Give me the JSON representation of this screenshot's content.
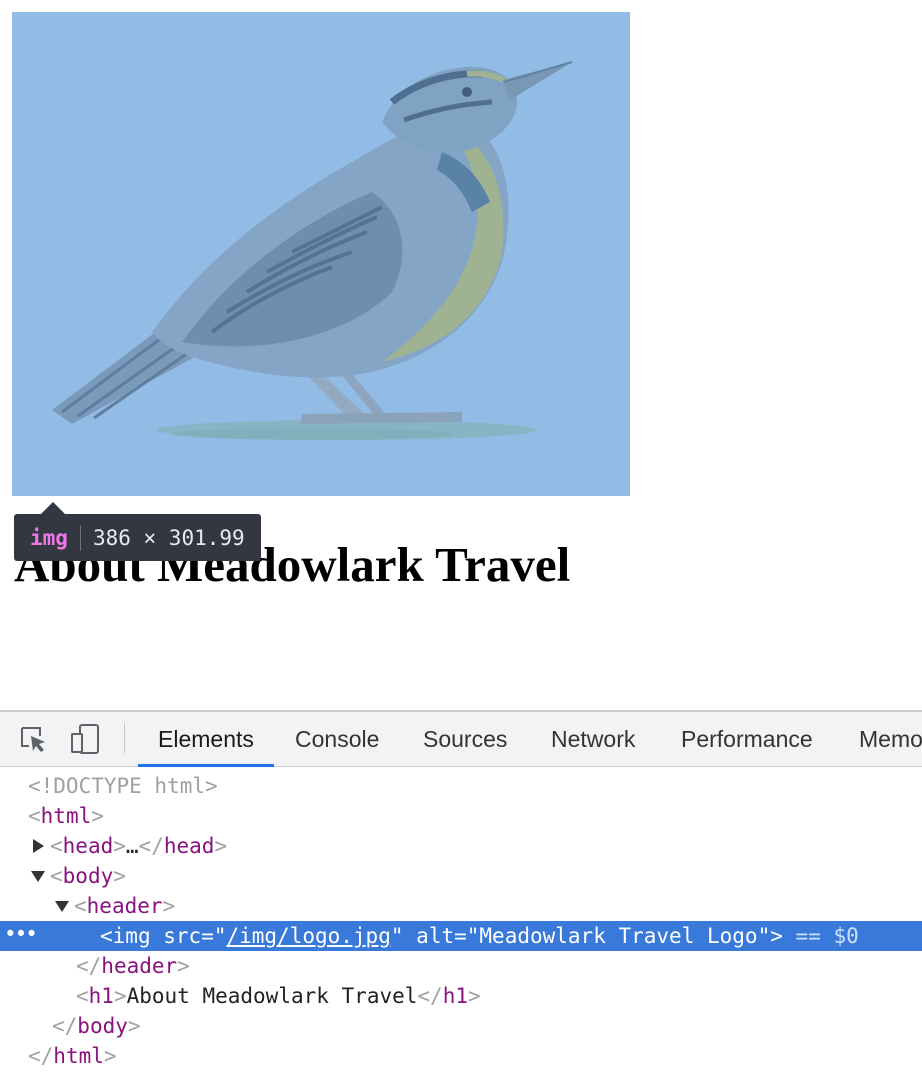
{
  "page": {
    "title": "About Meadowlark Travel",
    "logo_alt": "Meadowlark Travel Logo"
  },
  "tooltip": {
    "tag": "img",
    "size": "386 × 301.99"
  },
  "devtools": {
    "tabs": [
      "Elements",
      "Console",
      "Sources",
      "Network",
      "Performance",
      "Memo"
    ],
    "active_tab": "Elements",
    "icons": [
      "inspect-element-icon",
      "device-toolbar-icon"
    ],
    "tree": {
      "doctype": "<!DOCTYPE html>",
      "html_open": "html",
      "head_tag": "head",
      "head_ellipsis": "…",
      "body_tag": "body",
      "header_tag": "header",
      "img_tag": "img",
      "img_src_name": "src",
      "img_src_value": "/img/logo.jpg",
      "img_alt_name": "alt",
      "img_alt_value": "Meadowlark Travel Logo",
      "selected_marker": "== $0",
      "row_dots": "•••",
      "h1_tag": "h1",
      "h1_text": "About Meadowlark Travel"
    }
  },
  "colors": {
    "selection": "#3879d9",
    "tag": "#881280",
    "active_tab_underline": "#1a73e8",
    "logo_background": "#a5c7ea"
  }
}
